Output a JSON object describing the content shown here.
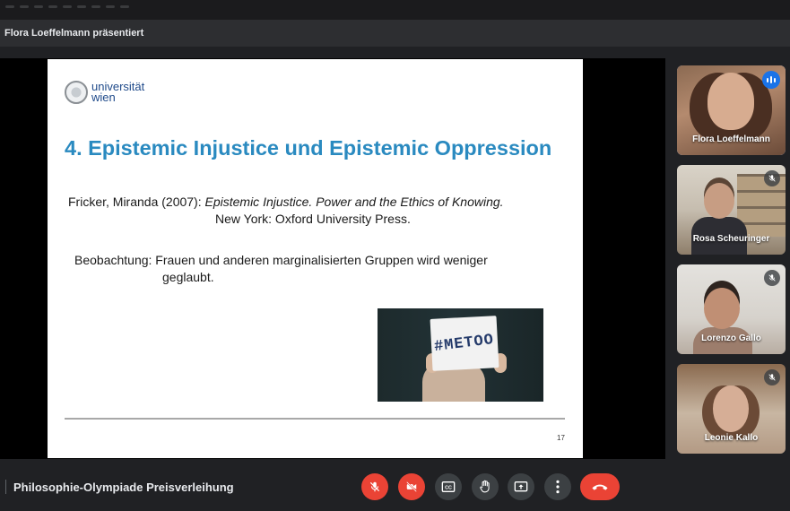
{
  "presenter_banner": "Flora Loeffelmann präsentiert",
  "slide": {
    "logo_text_line1": "universität",
    "logo_text_line2": "wien",
    "title": "4. Epistemic Injustice und Epistemic Oppression",
    "citation_author": "Fricker, Miranda (2007): ",
    "citation_title": "Epistemic Injustice. Power and the Ethics of Knowing.",
    "citation_publisher": "New York: Oxford University Press.",
    "observation_line1": "Beobachtung: Frauen und anderen marginalisierten Gruppen wird weniger",
    "observation_line2": "geglaubt.",
    "image_sign_text": "#METOO",
    "page_number": "17"
  },
  "participants": [
    {
      "name": "Flora Loeffelmann",
      "speaking": true
    },
    {
      "name": "Rosa Scheuringer",
      "muted": true
    },
    {
      "name": "Lorenzo Gallo",
      "muted": true
    },
    {
      "name": "Leonie Kallo",
      "muted": true
    }
  ],
  "meeting_title": "Philosophie-Olympiade Preisverleihung",
  "controls": [
    {
      "icon": "mic-off-icon",
      "state": "off"
    },
    {
      "icon": "camera-off-icon",
      "state": "off"
    },
    {
      "icon": "captions-icon"
    },
    {
      "icon": "raise-hand-icon"
    },
    {
      "icon": "present-screen-icon"
    },
    {
      "icon": "more-options-icon"
    },
    {
      "icon": "end-call-icon"
    }
  ],
  "colors": {
    "accent_blue": "#1a73e8",
    "danger_red": "#ea4335",
    "slide_title_blue": "#2a8ac0"
  }
}
